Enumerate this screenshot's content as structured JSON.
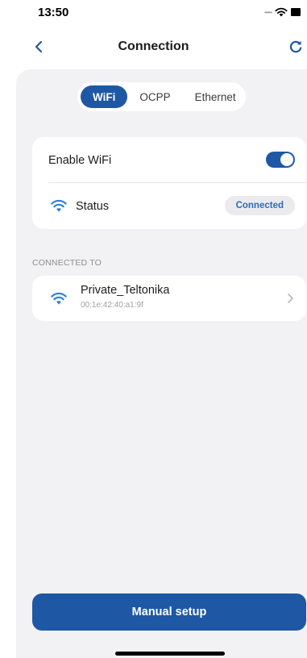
{
  "status_bar": {
    "time": "13:50",
    "icons": [
      "cellular-dots-icon",
      "wifi-icon",
      "battery-icon"
    ]
  },
  "nav": {
    "title": "Connection",
    "back_icon": "chevron-left-icon",
    "refresh_icon": "refresh-icon"
  },
  "tabs": [
    {
      "label": "WiFi",
      "active": true
    },
    {
      "label": "OCPP",
      "active": false
    },
    {
      "label": "Ethernet",
      "active": false
    }
  ],
  "wifi_card": {
    "enable_label": "Enable WiFi",
    "enabled": true,
    "status_label": "Status",
    "status_value": "Connected"
  },
  "connected_section": {
    "heading": "CONNECTED TO",
    "network": {
      "name": "Private_Teltonika",
      "mac": "00:1e:42:40:a1:9f"
    }
  },
  "manual_setup_label": "Manual setup",
  "colors": {
    "accent": "#1e58a5",
    "sheet_bg": "#f2f2f4",
    "status_text": "#2d6bb5"
  }
}
